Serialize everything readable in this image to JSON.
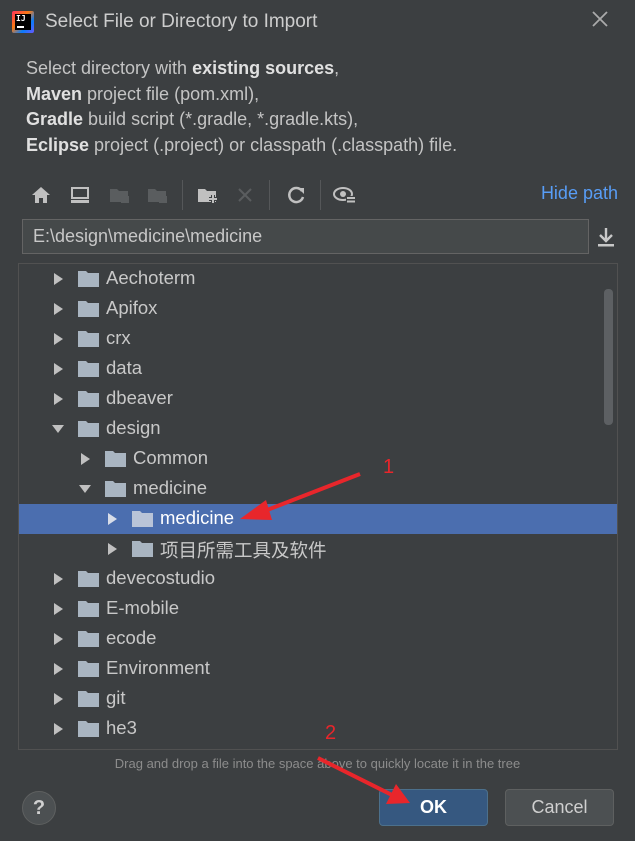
{
  "window": {
    "title": "Select File or Directory to Import",
    "logo_text": "IJ"
  },
  "description": {
    "line1_bold": "Select directory with ",
    "line1_strong": "existing sources",
    "line1_end": ",",
    "line2_strong": "Maven",
    "line2_rest": " project file (pom.xml),",
    "line3_strong": "Gradle",
    "line3_rest": " build script (*.gradle, *.gradle.kts),",
    "line4_strong": "Eclipse",
    "line4_rest": " project (.project) or classpath (.classpath) file."
  },
  "toolbar": {
    "hide_path_label": "Hide path"
  },
  "path": {
    "value": "E:\\design\\medicine\\medicine"
  },
  "tree": {
    "items": [
      {
        "label": "Aechoterm",
        "level": 0,
        "expanded": false,
        "selected": false
      },
      {
        "label": "Apifox",
        "level": 0,
        "expanded": false,
        "selected": false
      },
      {
        "label": "crx",
        "level": 0,
        "expanded": false,
        "selected": false
      },
      {
        "label": "data",
        "level": 0,
        "expanded": false,
        "selected": false
      },
      {
        "label": "dbeaver",
        "level": 0,
        "expanded": false,
        "selected": false
      },
      {
        "label": "design",
        "level": 0,
        "expanded": true,
        "selected": false
      },
      {
        "label": "Common",
        "level": 1,
        "expanded": false,
        "selected": false
      },
      {
        "label": "medicine",
        "level": 1,
        "expanded": true,
        "selected": false
      },
      {
        "label": "medicine",
        "level": 2,
        "expanded": false,
        "selected": true
      },
      {
        "label": "项目所需工具及软件",
        "level": 2,
        "expanded": false,
        "selected": false
      },
      {
        "label": "devecostudio",
        "level": 0,
        "expanded": false,
        "selected": false
      },
      {
        "label": "E-mobile",
        "level": 0,
        "expanded": false,
        "selected": false
      },
      {
        "label": "ecode",
        "level": 0,
        "expanded": false,
        "selected": false
      },
      {
        "label": "Environment",
        "level": 0,
        "expanded": false,
        "selected": false
      },
      {
        "label": "git",
        "level": 0,
        "expanded": false,
        "selected": false
      },
      {
        "label": "he3",
        "level": 0,
        "expanded": false,
        "selected": false
      }
    ]
  },
  "hint": "Drag and drop a file into the space above to quickly locate it in the tree",
  "buttons": {
    "help": "?",
    "ok": "OK",
    "cancel": "Cancel"
  },
  "annotations": {
    "marker1": "1",
    "marker2": "2",
    "color": "#e8262b"
  },
  "colors": {
    "background": "#3c3f41",
    "selection": "#4b6eaf",
    "link": "#589df6",
    "ok_button": "#365880"
  }
}
